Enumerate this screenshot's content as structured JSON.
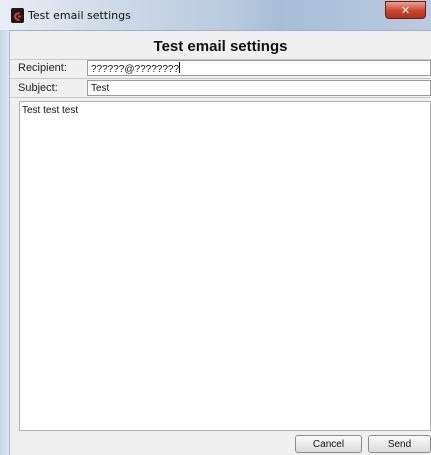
{
  "window": {
    "title": "Test email settings",
    "app_icon": "app-logo-icon",
    "close_glyph": "✕"
  },
  "dialog": {
    "heading": "Test email settings",
    "recipient_label": "Recipient:",
    "recipient_value": "??????@????????",
    "subject_label": "Subject:",
    "subject_value": "Test",
    "body_text": "Test test test"
  },
  "buttons": {
    "cancel": "Cancel",
    "send": "Send"
  },
  "colors": {
    "close_button": "#c8452e",
    "title_bar": "#b7c9dd"
  }
}
